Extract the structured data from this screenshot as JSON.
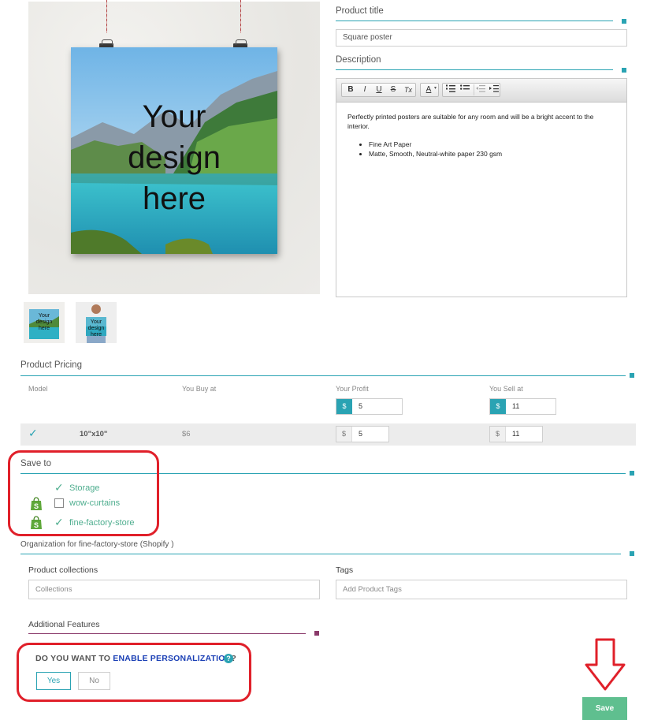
{
  "preview": {
    "poster_text": [
      "Your",
      "design",
      "here"
    ],
    "thumb_text": [
      "Your",
      "design",
      "here"
    ]
  },
  "product_title": {
    "label": "Product title",
    "value": "Square poster"
  },
  "description": {
    "label": "Description",
    "toolbar": [
      "B",
      "I",
      "U",
      "S",
      "Tx",
      "A",
      "list-numbered-icon",
      "list-bulleted-icon",
      "outdent-icon",
      "indent-icon"
    ],
    "paragraph": "Perfectly printed posters are suitable for any room and will be a bright accent to the interior.",
    "bullets": [
      "Fine Art Paper",
      "Matte, Smooth, Neutral-white paper 230 gsm"
    ]
  },
  "pricing": {
    "title": "Product Pricing",
    "headers": {
      "model": "Model",
      "buy": "You Buy at",
      "profit": "Your Profit",
      "sell": "You Sell at"
    },
    "currency": "$",
    "default_profit": "5",
    "default_sell": "11",
    "rows": [
      {
        "model": "10\"x10\"",
        "buy": "$6",
        "profit": "5",
        "sell": "11",
        "checked": true
      }
    ]
  },
  "save_to": {
    "title": "Save to",
    "stores": [
      {
        "name": "Storage",
        "checked": true,
        "shopify": false
      },
      {
        "name": "wow-curtains",
        "checked": false,
        "shopify": true
      },
      {
        "name": "fine-factory-store",
        "checked": true,
        "shopify": true
      }
    ]
  },
  "organization": {
    "title": "Organization for fine-factory-store (Shopify )",
    "collections_label": "Product collections",
    "collections_placeholder": "Collections",
    "tags_label": "Tags",
    "tags_placeholder": "Add Product Tags"
  },
  "additional": {
    "title": "Additional Features",
    "question_prefix": "DO YOU WANT TO ",
    "question_emphasis": "ENABLE PERSONALIZATION",
    "question_suffix": "?",
    "yes": "Yes",
    "no": "No"
  },
  "save_button": "Save",
  "colors": {
    "accent": "#2aa3b3",
    "highlight": "#e0202a",
    "save": "#5fbf8f",
    "store_green": "#4fae8f",
    "personalization_blue": "#1a3fb5",
    "additional_rule": "#8a3a6a"
  }
}
